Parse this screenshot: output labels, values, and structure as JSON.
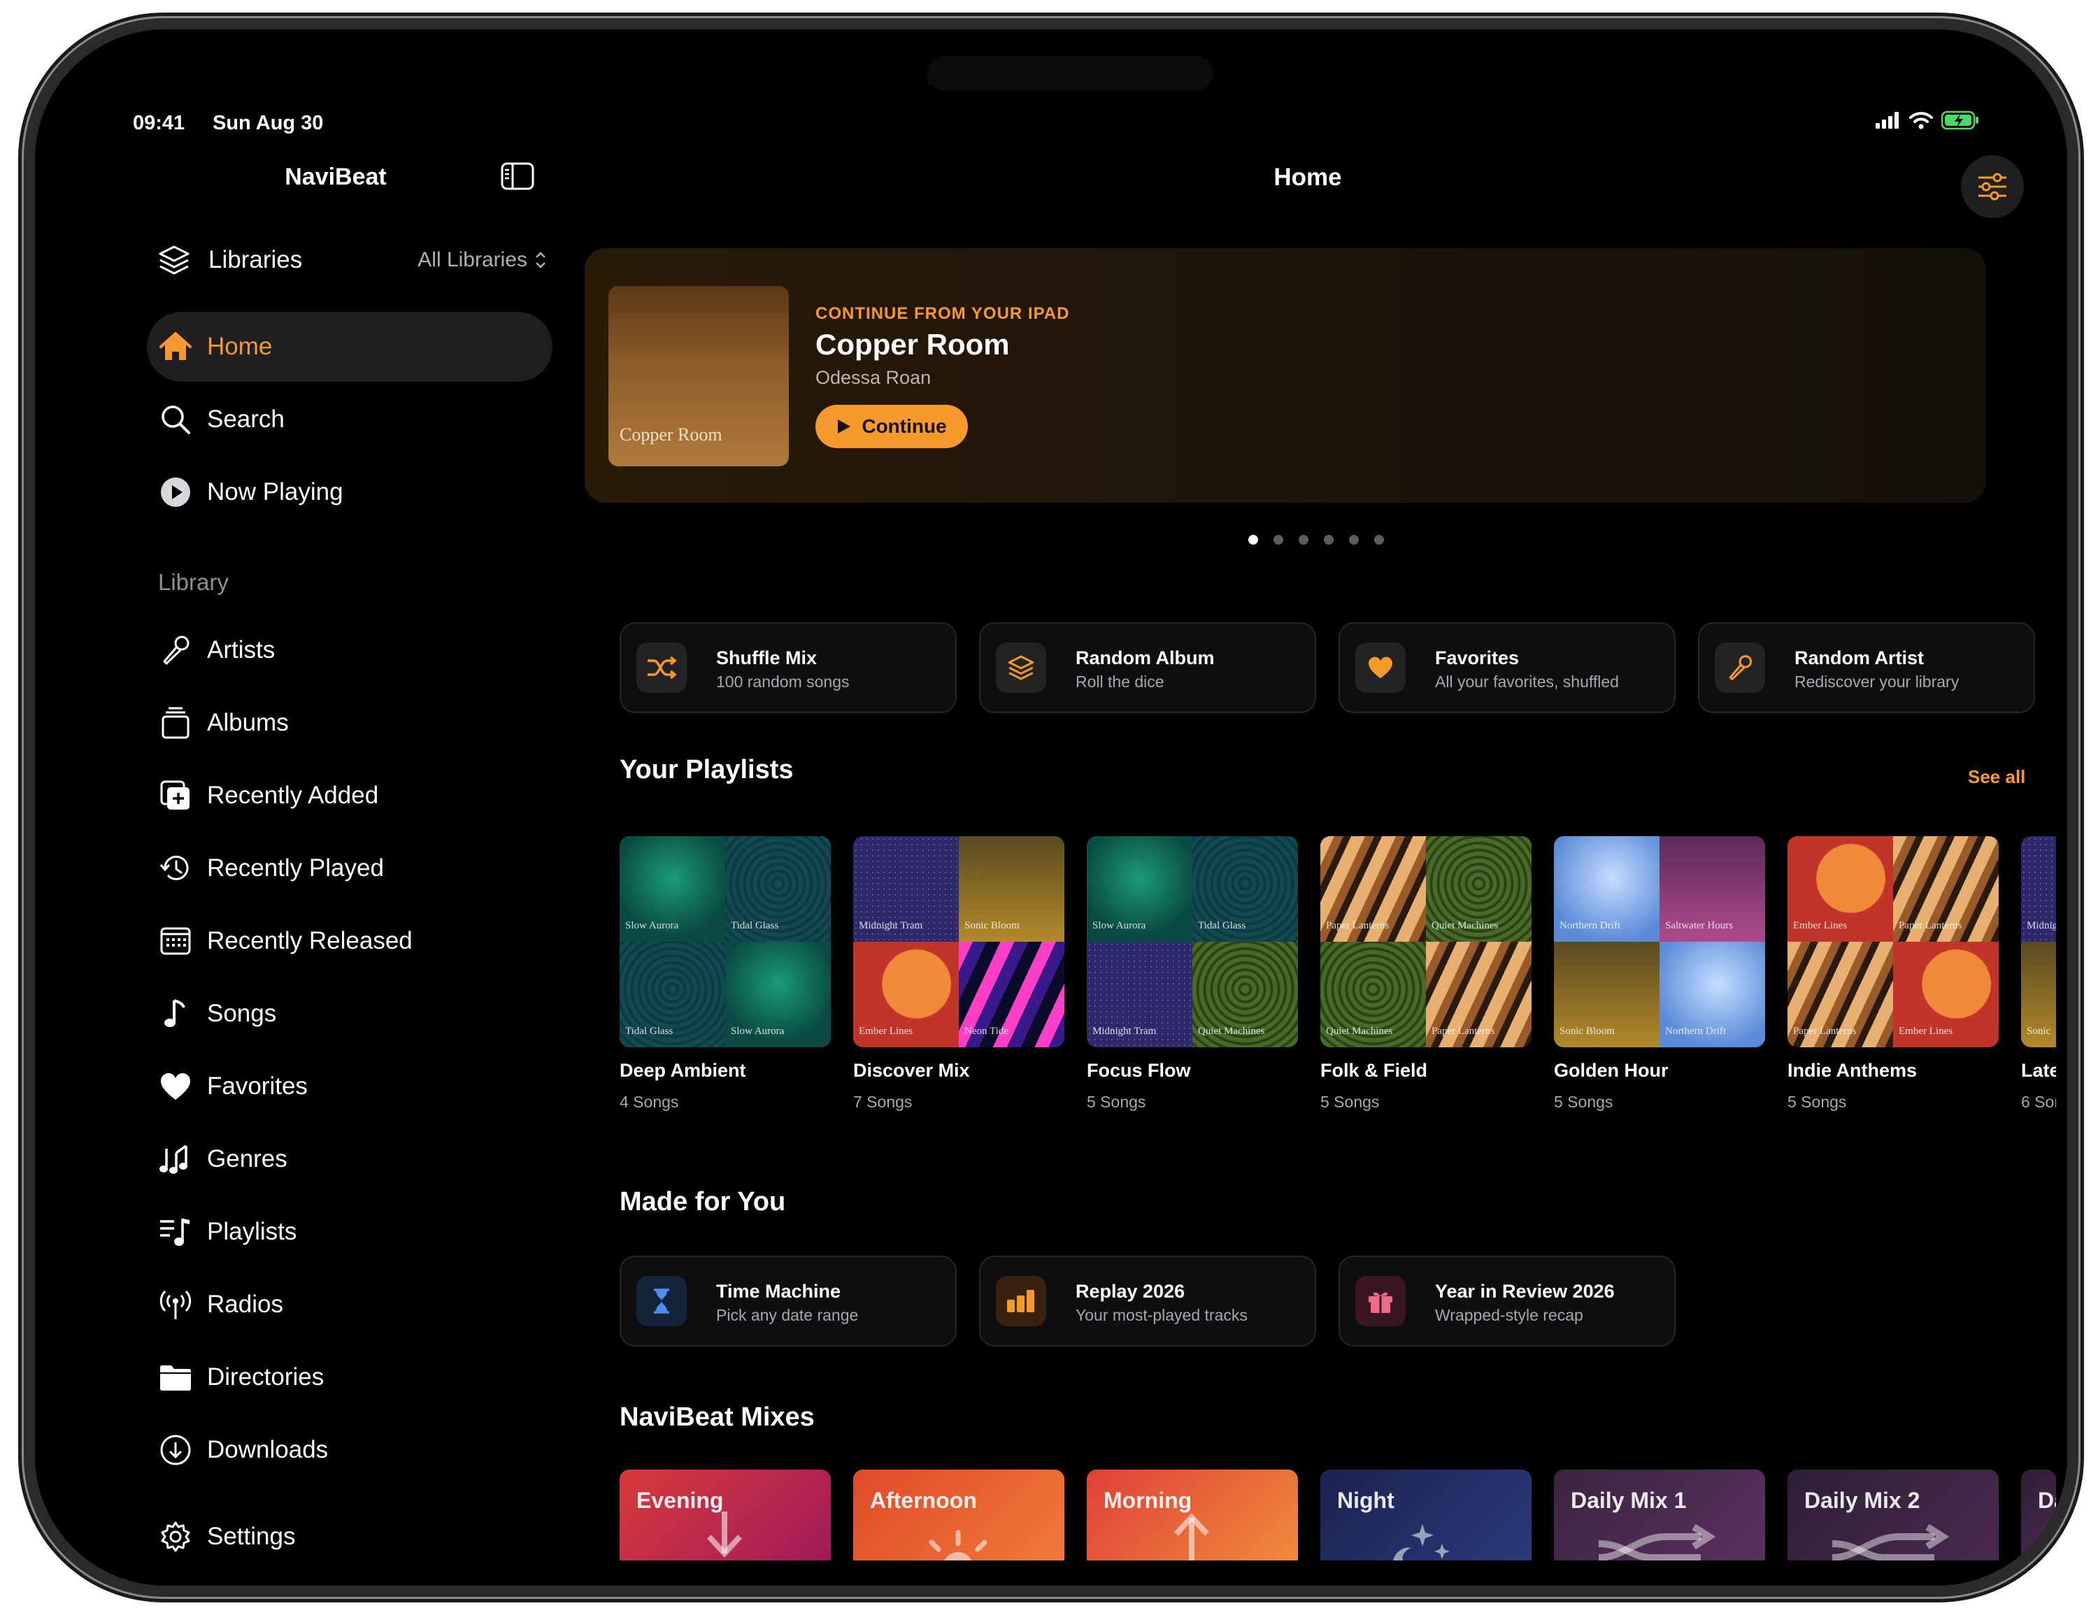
{
  "status": {
    "time": "09:41",
    "date": "Sun Aug 30"
  },
  "sidebar": {
    "app_title": "NaviBeat",
    "libraries": {
      "label": "Libraries",
      "value": "All Libraries"
    },
    "nav": [
      {
        "label": "Home",
        "icon": "house-icon"
      },
      {
        "label": "Search",
        "icon": "magnifier-icon"
      },
      {
        "label": "Now Playing",
        "icon": "play-circle-icon"
      }
    ],
    "library_header": "Library",
    "library": [
      {
        "label": "Artists",
        "icon": "microphone-icon"
      },
      {
        "label": "Albums",
        "icon": "album-stack-icon"
      },
      {
        "label": "Recently Added",
        "icon": "add-photo-icon"
      },
      {
        "label": "Recently Played",
        "icon": "history-icon"
      },
      {
        "label": "Recently Released",
        "icon": "calendar-icon"
      },
      {
        "label": "Songs",
        "icon": "music-note-icon"
      },
      {
        "label": "Favorites",
        "icon": "heart-icon"
      },
      {
        "label": "Genres",
        "icon": "music-notes-icon"
      },
      {
        "label": "Playlists",
        "icon": "playlist-icon"
      },
      {
        "label": "Radios",
        "icon": "antenna-icon"
      },
      {
        "label": "Directories",
        "icon": "folder-icon"
      },
      {
        "label": "Downloads",
        "icon": "download-circle-icon"
      },
      {
        "label": "Settings",
        "icon": "gear-icon"
      }
    ]
  },
  "main": {
    "title": "Home",
    "hero": {
      "kicker": "CONTINUE FROM YOUR IPAD",
      "title": "Copper Room",
      "artist": "Odessa Roan",
      "button": "Continue",
      "art_title": "Copper Room",
      "active_page": 1,
      "page_count": 6
    },
    "quick": [
      {
        "title": "Shuffle Mix",
        "sub": "100 random songs",
        "icon": "shuffle-icon"
      },
      {
        "title": "Random Album",
        "sub": "Roll the dice",
        "icon": "stack-icon"
      },
      {
        "title": "Favorites",
        "sub": "All your favorites, shuffled",
        "icon": "heart-icon"
      },
      {
        "title": "Random Artist",
        "sub": "Rediscover your library",
        "icon": "microphone-icon"
      }
    ],
    "playlists_title": "Your Playlists",
    "see_all": "See all",
    "playlists": [
      {
        "name": "Deep Ambient",
        "count": "4 Songs",
        "tiles": [
          "Slow Aurora",
          "Tidal Glass",
          "Tidal Glass",
          "Slow Aurora"
        ]
      },
      {
        "name": "Discover Mix",
        "count": "7 Songs",
        "tiles": [
          "Midnight Tram",
          "Sonic Bloom",
          "Ember Lines",
          "Neon Tide"
        ]
      },
      {
        "name": "Focus Flow",
        "count": "5 Songs",
        "tiles": [
          "Slow Aurora",
          "Tidal Glass",
          "Midnight Tram",
          "Quiet Machines"
        ]
      },
      {
        "name": "Folk & Field",
        "count": "5 Songs",
        "tiles": [
          "Paper Lanterns",
          "Quiet Machines",
          "Quiet Machines",
          "Paper Lanterns"
        ]
      },
      {
        "name": "Golden Hour",
        "count": "5 Songs",
        "tiles": [
          "Northern Drift",
          "Saltwater Hours",
          "Sonic Bloom",
          "Northern Drift"
        ]
      },
      {
        "name": "Indie Anthems",
        "count": "5 Songs",
        "tiles": [
          "Ember Lines",
          "Paper Lanterns",
          "Paper Lanterns",
          "Ember Lines"
        ]
      },
      {
        "name": "Late",
        "count": "6 Son",
        "tiles": [
          "Midnig",
          "",
          "Sonic",
          ""
        ]
      }
    ],
    "mfy_title": "Made for You",
    "mfy": [
      {
        "title": "Time Machine",
        "sub": "Pick any date range",
        "icon": "hourglass-icon"
      },
      {
        "title": "Replay 2026",
        "sub": "Your most-played tracks",
        "icon": "bar-chart-icon"
      },
      {
        "title": "Year in Review 2026",
        "sub": "Wrapped-style recap",
        "icon": "gift-icon"
      }
    ],
    "mixes_title": "NaviBeat Mixes",
    "mixes": [
      "Evening",
      "Afternoon",
      "Morning",
      "Night",
      "Daily Mix 1",
      "Daily Mix 2",
      "Da"
    ],
    "colors": {
      "accent": "#f79a2d",
      "background": "#000000"
    }
  }
}
